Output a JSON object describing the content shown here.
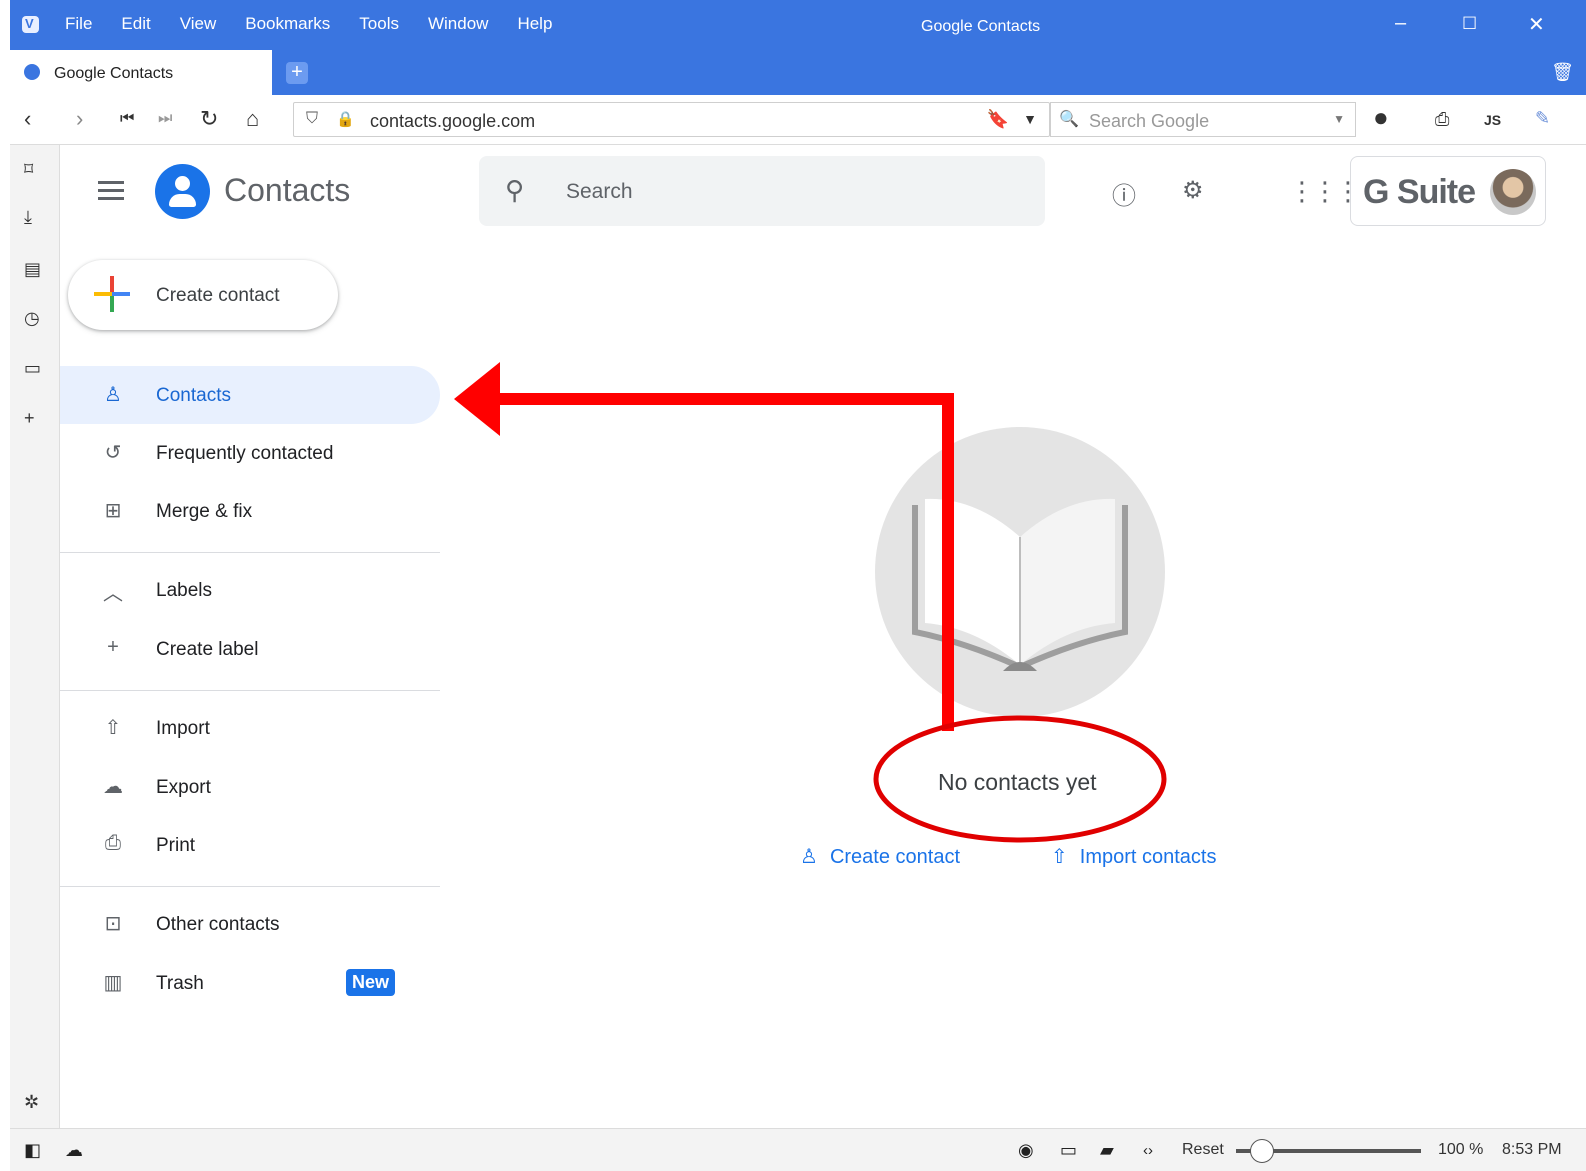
{
  "browser": {
    "menu": [
      "File",
      "Edit",
      "View",
      "Bookmarks",
      "Tools",
      "Window",
      "Help"
    ],
    "window_title": "Google Contacts",
    "tab_title": "Google Contacts",
    "url": "contacts.google.com",
    "search_placeholder": "Search Google",
    "js_label": "JS"
  },
  "app": {
    "title": "Contacts",
    "search_placeholder": "Search",
    "gsuite_label": "G Suite",
    "create_contact_label": "Create contact"
  },
  "nav": {
    "contacts": "Contacts",
    "frequently_contacted": "Frequently contacted",
    "merge_fix": "Merge & fix",
    "labels": "Labels",
    "create_label": "Create label",
    "import": "Import",
    "export": "Export",
    "print": "Print",
    "other_contacts": "Other contacts",
    "trash": "Trash",
    "trash_badge": "New"
  },
  "empty_state": {
    "message": "No contacts yet",
    "create_contact": "Create contact",
    "import_contacts": "Import contacts"
  },
  "statusbar": {
    "reset_label": "Reset",
    "zoom": "100 %",
    "time": "8:53 PM",
    "zoom_level_fraction": 0.14
  },
  "colors": {
    "browser_chrome": "#3a75e0",
    "accent": "#1a73e8",
    "active_nav_bg": "#e8f0fe",
    "annotation_red": "#ff0000"
  },
  "icons": {
    "sidebar": [
      "bookmark-icon",
      "download-icon",
      "notes-icon",
      "history-icon",
      "window-icon",
      "add-panel-icon",
      "settings-gear-icon"
    ]
  }
}
